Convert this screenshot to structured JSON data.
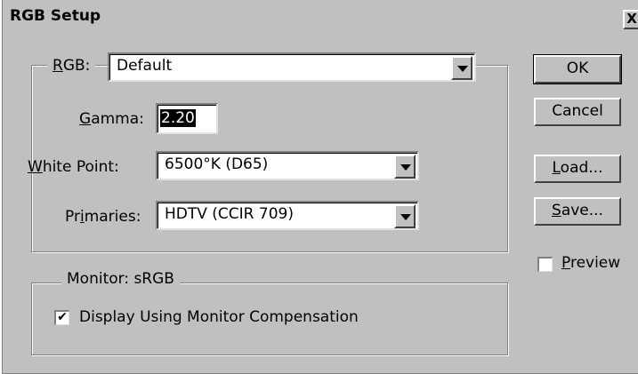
{
  "window": {
    "title": "RGB Setup",
    "close_glyph": "X"
  },
  "rgb_group": {
    "label_prefix": "",
    "label_accel": "R",
    "label_rest": "GB:",
    "selected": "Default"
  },
  "gamma": {
    "label_accel": "G",
    "label_rest": "amma:",
    "value": "2.20"
  },
  "white_point": {
    "label_accel": "W",
    "label_rest": "hite Point:",
    "selected": "6500°K (D65)"
  },
  "primaries": {
    "label_pre": "Pr",
    "label_accel": "i",
    "label_rest": "maries:",
    "selected": "HDTV (CCIR 709)"
  },
  "monitor_group": {
    "label": "Monitor:  sRGB",
    "compensation_label": "Display Using Monitor Compensation",
    "compensation_checked": "✔"
  },
  "buttons": {
    "ok": "OK",
    "cancel": "Cancel",
    "load_accel": "L",
    "load_rest": "oad...",
    "save_accel": "S",
    "save_rest": "ave..."
  },
  "preview": {
    "label_accel": "P",
    "label_rest": "review",
    "checked": ""
  },
  "icons": {
    "close": "close-icon",
    "dropdown": "chevron-down-icon",
    "check": "checkmark-icon"
  }
}
